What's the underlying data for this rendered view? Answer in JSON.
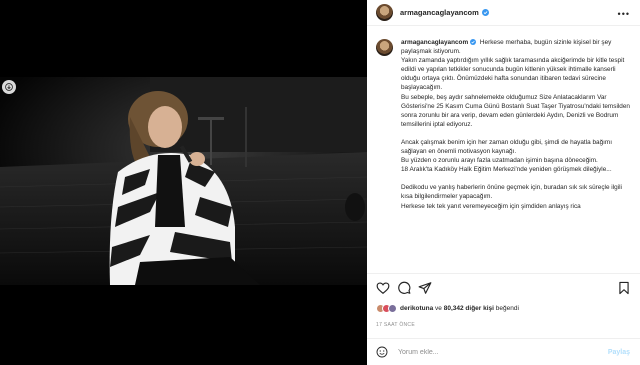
{
  "post": {
    "username": "armagancaglayancom",
    "caption_paragraphs": [
      "Herkese merhaba, bugün sizinle kişisel bir şey paylaşmak istiyorum.",
      "Yakın zamanda yaptırdığım yıllık sağlık taramasında akciğerimde bir kitle tespit edildi ve yapılan tetkikler sonucunda bugün kitlenin yüksek ihtimalle kanserli olduğu ortaya çıktı. Önümüzdeki hafta sonundan itibaren tedavi sürecine başlayacağım.",
      "Bu sebeple, beş aydır sahnelemekte olduğumuz Size Anlatacaklarım Var Gösterisi'ne 25 Kasım Cuma Günü Bostanlı Suat Taşer Tiyatrosu'ndaki temsilden sonra zorunlu bir ara verip, devam eden günlerdeki Aydın, Denizli ve Bodrum temsillerini iptal ediyoruz.",
      "",
      "Ancak çalışmak benim için her zaman olduğu gibi, şimdi de hayatla bağımı sağlayan en önemli motivasyon kaynağı.",
      "Bu yüzden o zorunlu arayı fazla uzatmadan işimin başına döneceğim.",
      "18 Aralık'ta Kadıköy Halk Eğitim Merkezi'nde yeniden görüşmek dileğiyle...",
      "",
      "Dedikodu ve yanlış haberlerin önüne geçmek için, buradan sık sık süreçle ilgili kısa bilgilendirmeler yapacağım.",
      "Herkese tek tek yanıt veremeyeceğim için şimdiden anlayış rica"
    ],
    "liked_by_user": "derikotuna",
    "likes_connector": "ve",
    "likes_count": "80,342 diğer kişi",
    "likes_suffix": "beğendi",
    "timestamp": "17 SAAT ÖNCE",
    "comment_placeholder": "Yorum ekle...",
    "post_button": "Paylaş",
    "more_label": "•••"
  },
  "colors": {
    "verified": "#3897f0",
    "secondary_text": "#8e8e8e",
    "post_button_disabled": "#b2dffc"
  },
  "icons": [
    "heart-icon",
    "comment-icon",
    "share-icon",
    "bookmark-icon",
    "emoji-icon",
    "verified-badge-icon",
    "chevron-left-icon",
    "more-icon"
  ]
}
